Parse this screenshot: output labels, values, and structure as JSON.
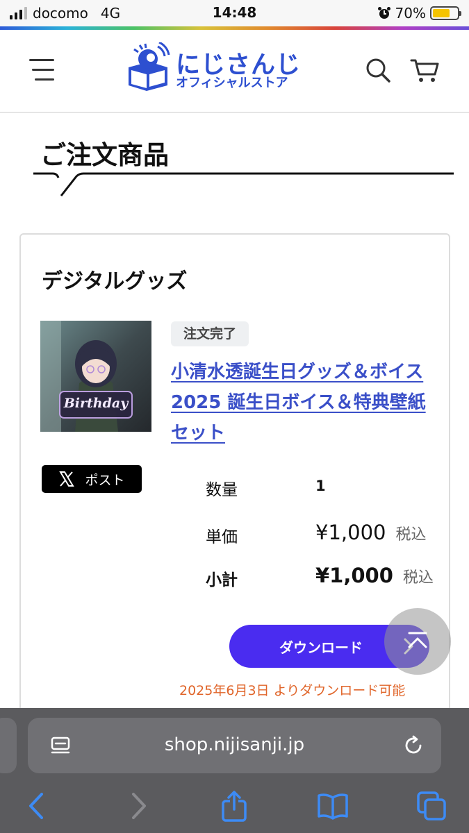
{
  "status_bar": {
    "carrier": "docomo",
    "network": "4G",
    "time": "14:48",
    "battery_text": "70%",
    "battery_level": 0.7,
    "battery_color": "#f5c400"
  },
  "header": {
    "menu_icon": "hamburger-icon",
    "logo_main": "にじさんじ",
    "logo_sub": "オフィシャルストア",
    "search_icon": "search-icon",
    "cart_icon": "cart-icon",
    "brand_color": "#2d4fd0"
  },
  "page": {
    "title": "ご注文商品"
  },
  "order": {
    "category": "デジタルグッズ",
    "status": "注文完了",
    "product_title": "小清水透誕生日グッズ＆ボイス2025 誕生日ボイス＆特典壁紙セット",
    "thumbnail_text": "Birthday",
    "post_button": "ポスト",
    "quantity_label": "数量",
    "quantity_value": "1",
    "unit_price_label": "単価",
    "unit_price_value": "¥1,000",
    "unit_price_tax": "税込",
    "subtotal_label": "小計",
    "subtotal_value": "¥1,000",
    "subtotal_tax": "税込",
    "download_button": "ダウンロード",
    "download_note": "2025年6月3日 よりダウンロード可能",
    "button_color": "#4a2cf0",
    "note_color": "#e0652a",
    "link_color": "#3a4fc8"
  },
  "browser": {
    "url": "shop.nijisanji.jp",
    "toolbar_icons": [
      "back-icon",
      "forward-icon",
      "share-icon",
      "bookmarks-icon",
      "tabs-icon"
    ]
  }
}
